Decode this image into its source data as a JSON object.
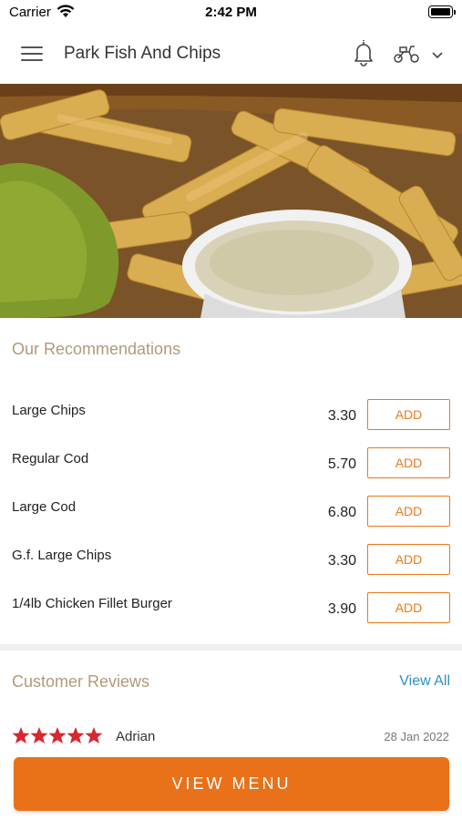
{
  "status_bar": {
    "carrier": "Carrier",
    "time": "2:42 PM",
    "icons": [
      "wifi-icon",
      "battery-icon"
    ]
  },
  "header": {
    "title": "Park Fish And Chips",
    "icons": [
      "hamburger-menu-icon",
      "bell-icon",
      "scooter-icon",
      "chevron-down-icon"
    ]
  },
  "hero": {
    "description_icon": "food-banner-image"
  },
  "recommendations": {
    "title": "Our Recommendations",
    "items": [
      {
        "name": "Large Chips",
        "price": "3.30",
        "button": "ADD"
      },
      {
        "name": "Regular Cod",
        "price": "5.70",
        "button": "ADD"
      },
      {
        "name": "Large Cod",
        "price": "6.80",
        "button": "ADD"
      },
      {
        "name": "G.f. Large Chips",
        "price": "3.30",
        "button": "ADD"
      },
      {
        "name": "1/4lb Chicken Fillet Burger",
        "price": "3.90",
        "button": "ADD"
      }
    ]
  },
  "reviews": {
    "title": "Customer Reviews",
    "view_all": "View All",
    "items": [
      {
        "rating": 5,
        "max_rating": 5,
        "reviewer": "Adrian",
        "date": "28 Jan 2022"
      }
    ]
  },
  "bottom": {
    "view_menu": "VIEW MENU"
  },
  "colors": {
    "accent": "#e97119",
    "section_title": "#b09a7a",
    "link": "#2e8fc5",
    "star": "#d6282f"
  }
}
